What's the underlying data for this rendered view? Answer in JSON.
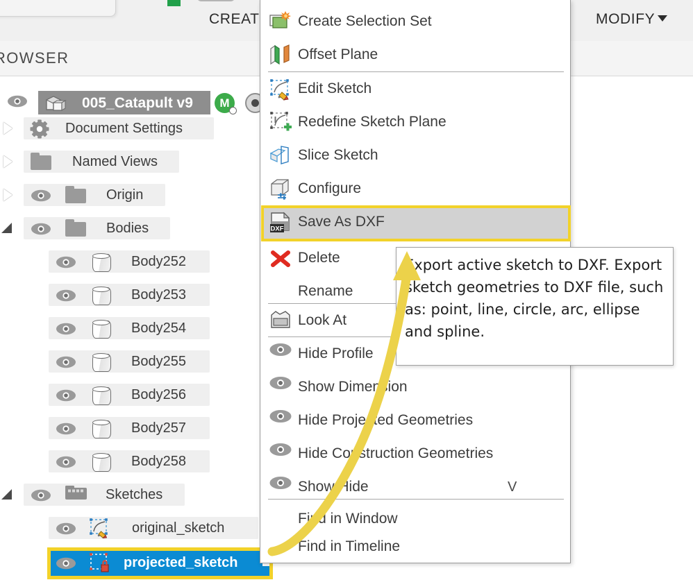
{
  "ribbon": {
    "create_label": "CREATE",
    "modify_label": "MODIFY",
    "caret_icon": "chevron-down-icon"
  },
  "browser": {
    "title": "ROWSER",
    "root": {
      "label": "005_Catapult v9",
      "badge_m": "M",
      "icons": [
        "eye-icon",
        "assembly-icon",
        "m-badge-icon",
        "target-icon"
      ]
    },
    "tree": [
      {
        "label": "Document Settings",
        "icon": "gear-icon",
        "expander": "closed",
        "eye": false,
        "indent": 0
      },
      {
        "label": "Named Views",
        "icon": "folder-icon",
        "expander": "closed",
        "eye": false,
        "indent": 0
      },
      {
        "label": "Origin",
        "icon": "folder-icon",
        "expander": "closed",
        "eye": true,
        "indent": 0
      },
      {
        "label": "Bodies",
        "icon": "folder-icon",
        "expander": "open",
        "eye": true,
        "indent": 0
      },
      {
        "label": "Body252",
        "icon": "body-icon",
        "expander": "none",
        "eye": true,
        "indent": 1
      },
      {
        "label": "Body253",
        "icon": "body-icon",
        "expander": "none",
        "eye": true,
        "indent": 1
      },
      {
        "label": "Body254",
        "icon": "body-icon",
        "expander": "none",
        "eye": true,
        "indent": 1
      },
      {
        "label": "Body255",
        "icon": "body-icon",
        "expander": "none",
        "eye": true,
        "indent": 1
      },
      {
        "label": "Body256",
        "icon": "body-icon",
        "expander": "none",
        "eye": true,
        "indent": 1
      },
      {
        "label": "Body257",
        "icon": "body-icon",
        "expander": "none",
        "eye": true,
        "indent": 1
      },
      {
        "label": "Body258",
        "icon": "body-icon",
        "expander": "none",
        "eye": true,
        "indent": 1
      },
      {
        "label": "Sketches",
        "icon": "sketches-folder-icon",
        "expander": "open",
        "eye": true,
        "indent": 0
      },
      {
        "label": "original_sketch",
        "icon": "sketch-icon",
        "expander": "none",
        "eye": true,
        "indent": 1
      }
    ],
    "selected_item": {
      "label": "projected_sketch",
      "icon": "locked-sketch-icon",
      "eye": true,
      "selected": true,
      "highlight_color": "#f2d22a",
      "selection_color": "#0b8bd3"
    }
  },
  "context_menu": {
    "items": [
      {
        "label": "Create Selection Set",
        "icon": "selection-set-icon",
        "shortcut": "",
        "highlighted": false
      },
      {
        "label": "Offset Plane",
        "icon": "offset-plane-icon",
        "shortcut": "",
        "highlighted": false
      },
      {
        "label": "Edit Sketch",
        "icon": "edit-sketch-icon",
        "shortcut": "",
        "highlighted": false
      },
      {
        "label": "Redefine Sketch Plane",
        "icon": "redefine-sketch-plane-icon",
        "shortcut": "",
        "highlighted": false
      },
      {
        "label": "Slice Sketch",
        "icon": "slice-sketch-icon",
        "shortcut": "",
        "highlighted": false
      },
      {
        "label": "Configure",
        "icon": "configure-icon",
        "shortcut": "",
        "highlighted": false
      },
      {
        "label": "Save As DXF",
        "icon": "dxf-file-icon",
        "shortcut": "",
        "highlighted": true
      },
      {
        "label": "Delete",
        "icon": "delete-x-icon",
        "shortcut": "",
        "highlighted": false
      },
      {
        "label": "Rename",
        "icon": "",
        "shortcut": "",
        "highlighted": false
      },
      {
        "label": "Look At",
        "icon": "look-at-icon",
        "shortcut": "",
        "highlighted": false
      },
      {
        "label": "Hide Profile",
        "icon": "eye-icon",
        "shortcut": "",
        "highlighted": false
      },
      {
        "label": "Show Dimension",
        "icon": "eye-icon",
        "shortcut": "",
        "highlighted": false
      },
      {
        "label": "Hide Projected Geometries",
        "icon": "eye-icon",
        "shortcut": "",
        "highlighted": false
      },
      {
        "label": "Hide Construction Geometries",
        "icon": "eye-icon",
        "shortcut": "",
        "highlighted": false
      },
      {
        "label": "Show/Hide",
        "icon": "eye-icon",
        "shortcut": "V",
        "highlighted": false
      },
      {
        "label": "Find in Window",
        "icon": "",
        "shortcut": "",
        "highlighted": false
      },
      {
        "label": "Find in Timeline",
        "icon": "",
        "shortcut": "",
        "highlighted": false
      }
    ],
    "highlight_color": "#f2d22a"
  },
  "tooltip": {
    "text": "Export active sketch to DXF. Export sketch geometries to DXF file, such as: point, line, circle, arc, ellipse and spline."
  },
  "annotation": {
    "arrow_color": "#ecd24a",
    "arrow_name": "callout-arrow"
  }
}
